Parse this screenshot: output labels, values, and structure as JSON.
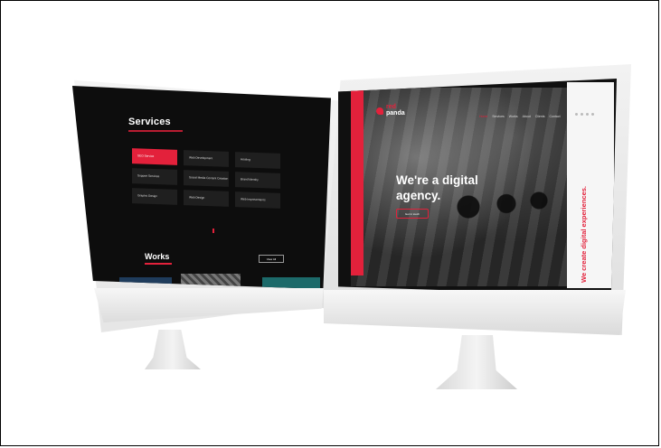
{
  "left_screen": {
    "services_title": "Services",
    "services": [
      {
        "label": "SEO Service",
        "active": true
      },
      {
        "label": "Web Development",
        "active": false
      },
      {
        "label": "Hosting",
        "active": false
      },
      {
        "label": "Support Services",
        "active": false
      },
      {
        "label": "Social Media Content Creation",
        "active": false
      },
      {
        "label": "Brand Identity",
        "active": false
      },
      {
        "label": "Graphic Design",
        "active": false
      },
      {
        "label": "Web Design",
        "active": false
      },
      {
        "label": "Web Improvements",
        "active": false
      }
    ],
    "works_title": "Works",
    "view_all_label": "View All"
  },
  "right_screen": {
    "logo_line1": "red",
    "logo_line2": "panda",
    "nav": [
      {
        "label": "Home",
        "active": true
      },
      {
        "label": "Services",
        "active": false
      },
      {
        "label": "Works",
        "active": false
      },
      {
        "label": "About",
        "active": false
      },
      {
        "label": "Clients",
        "active": false
      },
      {
        "label": "Contact",
        "active": false
      }
    ],
    "headline": "We're a digital agency.",
    "cta_label": "Get in touch",
    "vertical_text": "We create digital experiences."
  },
  "colors": {
    "accent": "#e3213b",
    "screen_bg": "#0d0d0d",
    "tile_bg": "#1f1f1f"
  }
}
